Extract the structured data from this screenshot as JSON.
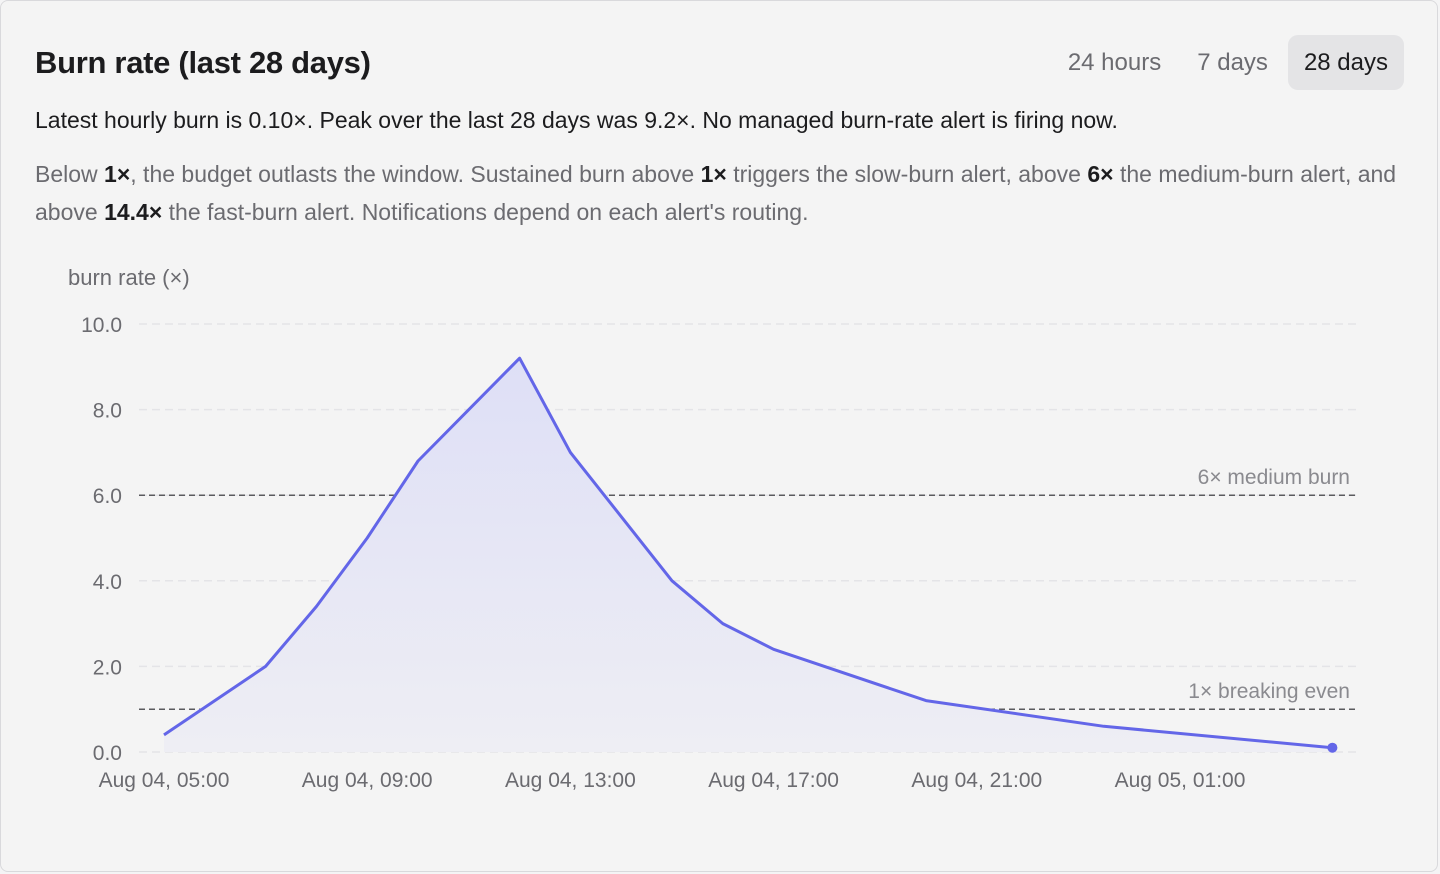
{
  "title": "Burn rate (last 28 days)",
  "ranges": [
    {
      "label": "24 hours",
      "active": false
    },
    {
      "label": "7 days",
      "active": false
    },
    {
      "label": "28 days",
      "active": true
    }
  ],
  "summary": "Latest hourly burn is 0.10×. Peak over the last 28 days was 9.2×. No managed burn-rate alert is firing now.",
  "explain": {
    "t1": "Below ",
    "b1": "1×",
    "t2": ", the budget outlasts the window. Sustained burn above ",
    "b2": "1×",
    "t3": " triggers the slow-burn alert, above ",
    "b3": "6×",
    "t4": " the medium-burn alert, and above ",
    "b4": "14.4×",
    "t5": " the fast-burn alert. Notifications depend on each alert's routing."
  },
  "colors": {
    "line": "#6366e8",
    "fill": "#e6e6f6",
    "grid": "#e4e4e7",
    "ref": "#5a5a5e"
  },
  "chart_data": {
    "type": "area",
    "ylabel": "burn rate (×)",
    "xlabel": "",
    "ylim": [
      0,
      10
    ],
    "yticks": [
      "0.0",
      "2.0",
      "4.0",
      "6.0",
      "8.0",
      "10.0"
    ],
    "xticks": [
      "Aug 04, 05:00",
      "Aug 04, 09:00",
      "Aug 04, 13:00",
      "Aug 04, 17:00",
      "Aug 04, 21:00",
      "Aug 05, 01:00"
    ],
    "grid": true,
    "series": [
      {
        "x": [
          "Aug 04, 05:00",
          "Aug 04, 07:00",
          "Aug 04, 08:00",
          "Aug 04, 09:00",
          "Aug 04, 10:00",
          "Aug 04, 12:00",
          "Aug 04, 13:00",
          "Aug 04, 15:00",
          "Aug 04, 16:00",
          "Aug 04, 17:00",
          "Aug 04, 20:00",
          "Aug 04, 23:30",
          "Aug 05, 04:00"
        ],
        "y": [
          0.4,
          2.0,
          3.4,
          5.0,
          6.8,
          9.2,
          7.0,
          4.0,
          3.0,
          2.4,
          1.2,
          0.6,
          0.1
        ]
      }
    ],
    "reference_lines": [
      {
        "value": 6,
        "label": "6× medium burn"
      },
      {
        "value": 1,
        "label": "1× breaking even"
      }
    ]
  }
}
